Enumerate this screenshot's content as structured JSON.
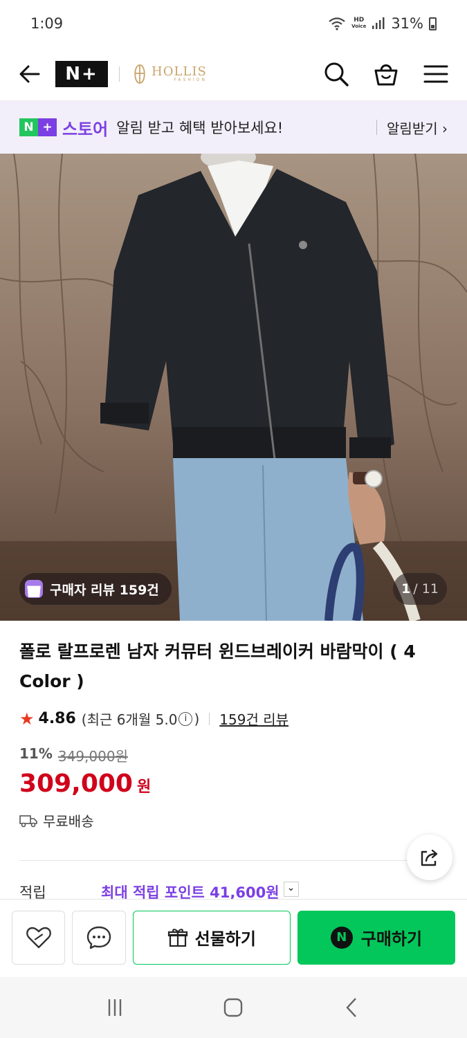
{
  "status_bar": {
    "time": "1:09",
    "hd_top": "HD",
    "hd_bottom": "Voice",
    "battery": "31%"
  },
  "header": {
    "store_logo": "N+",
    "brand_name": "HOLLIS",
    "brand_sub": "FASHION"
  },
  "banner": {
    "logo_n": "N",
    "logo_plus": "+",
    "store_label": "스토어",
    "message": "알림 받고 혜택 받아보세요!",
    "action_label": "알림받기 ›"
  },
  "hero": {
    "review_chip": "구매자 리뷰 159건",
    "page_current": "1",
    "page_total": "/ 11"
  },
  "product": {
    "title": "폴로 랄프로렌 남자 커뮤터 윈드브레이커 바람막이 ( 4 Color )",
    "rating": "4.86",
    "recent_rating_prefix": "(최근 6개월 5.0",
    "recent_rating_suffix": ")",
    "info_icon": "i",
    "review_count": "159건 리뷰",
    "discount_percent": "11%",
    "original_price": "349,000원",
    "sale_price": "309,000",
    "currency": "원",
    "shipping": "무료배송",
    "points_label": "적립",
    "points_value": "최대 적립 포인트 41,600원"
  },
  "actions": {
    "gift_label": "선물하기",
    "buy_label": "구매하기",
    "buy_icon_letter": "N"
  },
  "colors": {
    "naver_green": "#03c75a",
    "store_purple": "#7b3fe4",
    "price_red": "#d0021b",
    "star": "#e8391f"
  }
}
